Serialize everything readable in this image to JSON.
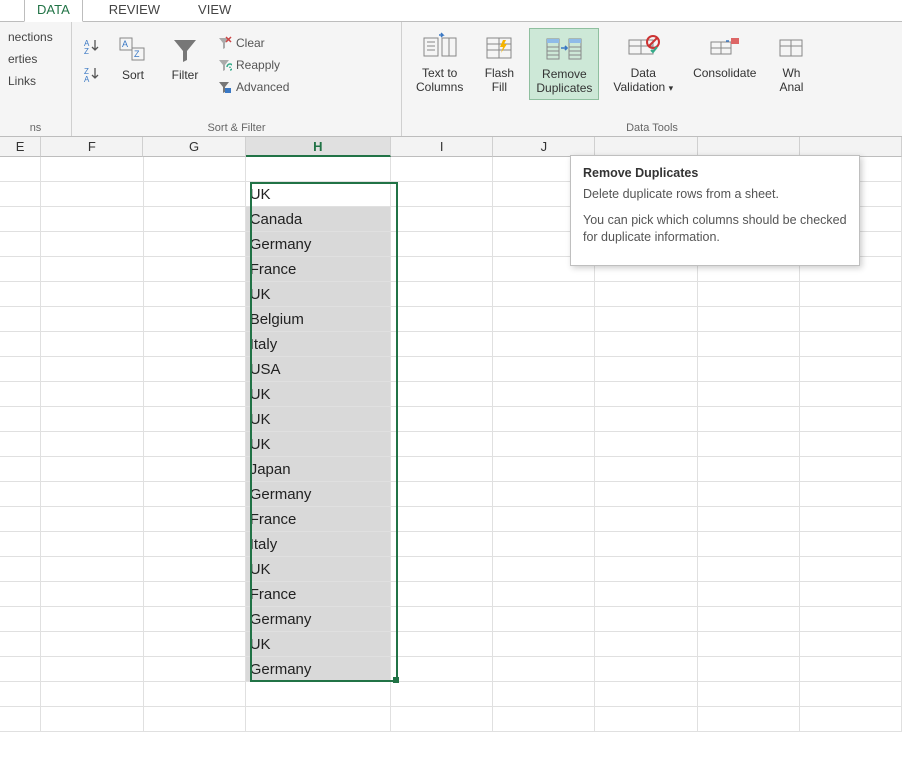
{
  "tabs": {
    "data": "DATA",
    "review": "REVIEW",
    "view": "VIEW"
  },
  "conn": {
    "l1": "nections",
    "l2": "erties",
    "l3": "Links",
    "l4": "ns"
  },
  "sort": "Sort",
  "filter": "Filter",
  "clear": "Clear",
  "reapply": "Reapply",
  "advanced": "Advanced",
  "sortfilter_label": "Sort & Filter",
  "text_to1": "Text to",
  "text_to2": "Columns",
  "flash1": "Flash",
  "flash2": "Fill",
  "remove1": "Remove",
  "remove2": "Duplicates",
  "datav1": "Data",
  "datav2": "Validation",
  "consolidate": "Consolidate",
  "what1": "Wh",
  "what2": "Anal",
  "datatools_label": "Data Tools",
  "cols": {
    "e": "E",
    "f": "F",
    "g": "G",
    "h": "H",
    "i": "I",
    "j": "J"
  },
  "data_h": [
    "UK",
    "Canada",
    "Germany",
    "France",
    "UK",
    "Belgium",
    "Italy",
    "USA",
    "UK",
    "UK",
    "UK",
    "Japan",
    "Germany",
    "France",
    "Italy",
    "UK",
    "France",
    "Germany",
    "UK",
    "Germany"
  ],
  "tooltip": {
    "title": "Remove Duplicates",
    "p1": "Delete duplicate rows from a sheet.",
    "p2": "You can pick which columns should be checked for duplicate information."
  }
}
